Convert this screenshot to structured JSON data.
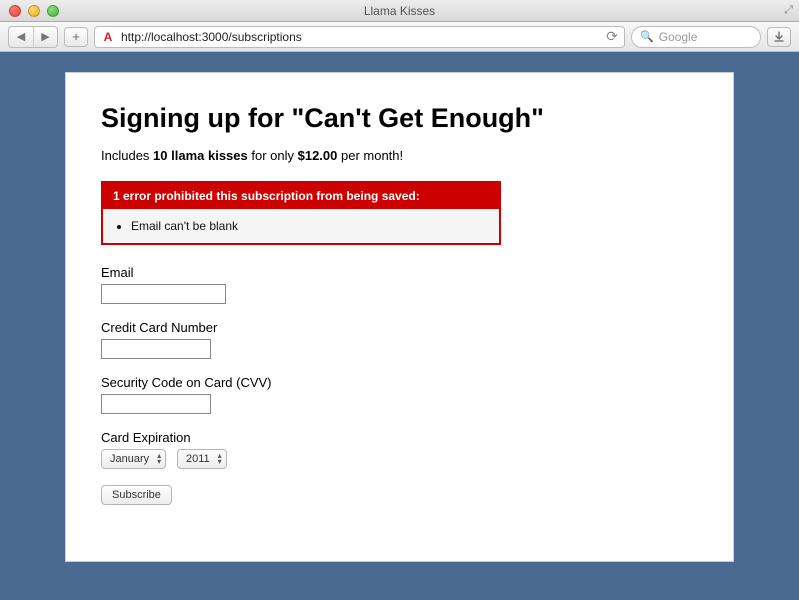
{
  "window": {
    "title": "Llama Kisses"
  },
  "browser": {
    "url": "http://localhost:3000/subscriptions",
    "search_placeholder": "Google"
  },
  "page": {
    "heading": "Signing up for \"Can't Get Enough\"",
    "plan_prefix": "Includes ",
    "plan_kisses": "10 llama kisses",
    "plan_mid": " for only ",
    "plan_price": "$12.00",
    "plan_suffix": " per month!"
  },
  "errors": {
    "header": "1 error prohibited this subscription from being saved:",
    "items": [
      "Email can't be blank"
    ]
  },
  "form": {
    "email": {
      "label": "Email",
      "value": ""
    },
    "card_number": {
      "label": "Credit Card Number",
      "value": ""
    },
    "cvv": {
      "label": "Security Code on Card (CVV)",
      "value": ""
    },
    "expiration": {
      "label": "Card Expiration",
      "month": "January",
      "year": "2011"
    },
    "submit_label": "Subscribe"
  }
}
